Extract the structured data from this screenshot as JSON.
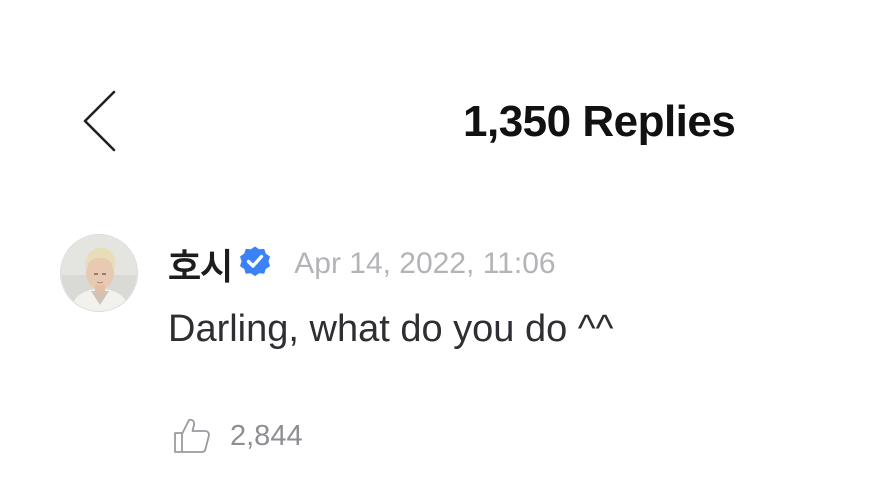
{
  "header": {
    "back_icon": "chevron-left-icon",
    "title": "1,350 Replies"
  },
  "comment": {
    "avatar_icon": "user-avatar",
    "author": "호시",
    "verified_icon": "verified-badge-icon",
    "verified_color": "#3b82f6",
    "timestamp": "Apr 14, 2022, 11:06",
    "text": "Darling, what do you do ^^",
    "like_icon": "thumbs-up-icon",
    "like_count": "2,844"
  }
}
